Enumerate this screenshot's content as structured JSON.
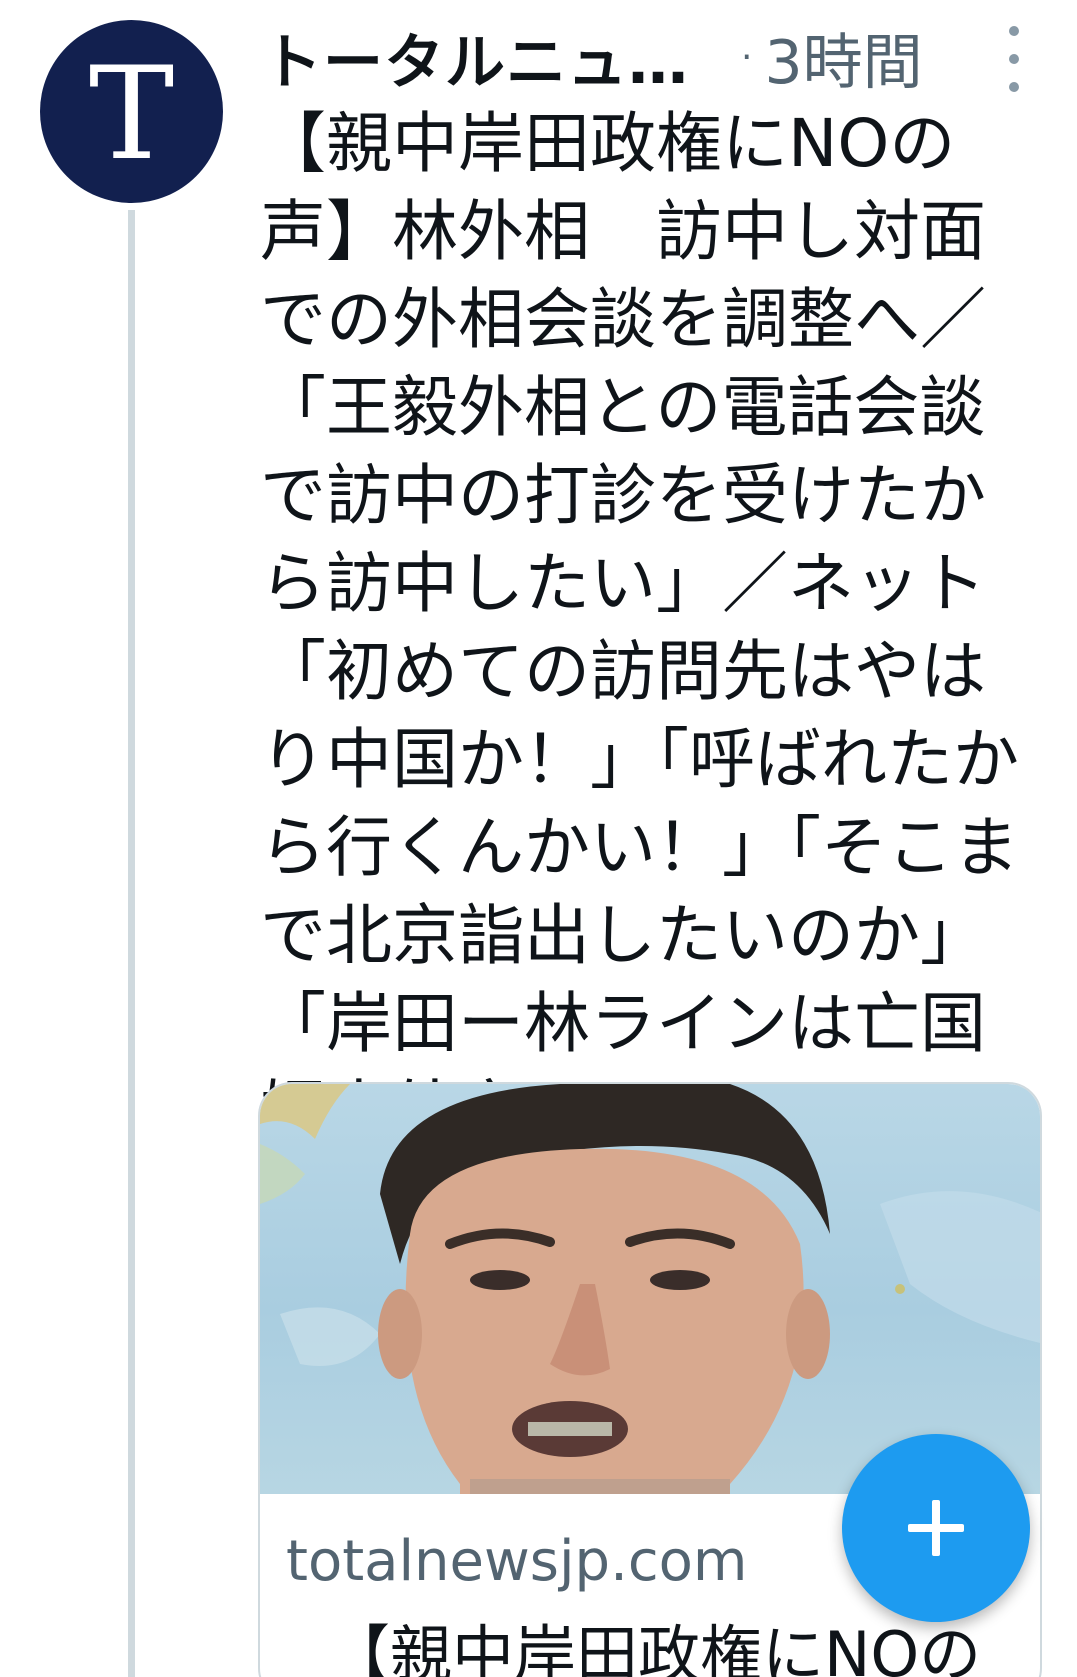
{
  "avatar": {
    "letter": "T",
    "icon": "avatar-icon",
    "background": "#12204f"
  },
  "header": {
    "display_name": "トータルニュ…",
    "separator": "·",
    "timestamp": "3時間",
    "more_icon": "more-vertical-icon"
  },
  "tweet": {
    "text": "【親中岸田政権にNOの声】林外相　訪中し対面での外相会談を調整へ／「王毅外相との電話会談で訪中の打診を受けたから訪中したい」／ネット「初めての訪問先はやはり中国か！」「呼ばれたから行くんかい！」「そこまで北京詣出したいのか」「岸田ー林ラインは亡国媚中外交」"
  },
  "link_card": {
    "domain": "totalnewsjp.com",
    "title": "【親中岸田政権にNOの"
  },
  "fab": {
    "icon": "plus-icon",
    "color": "#1d9bf0"
  },
  "colors": {
    "text_primary": "#0f1419",
    "text_secondary": "#536471",
    "divider": "#cfd9de"
  }
}
